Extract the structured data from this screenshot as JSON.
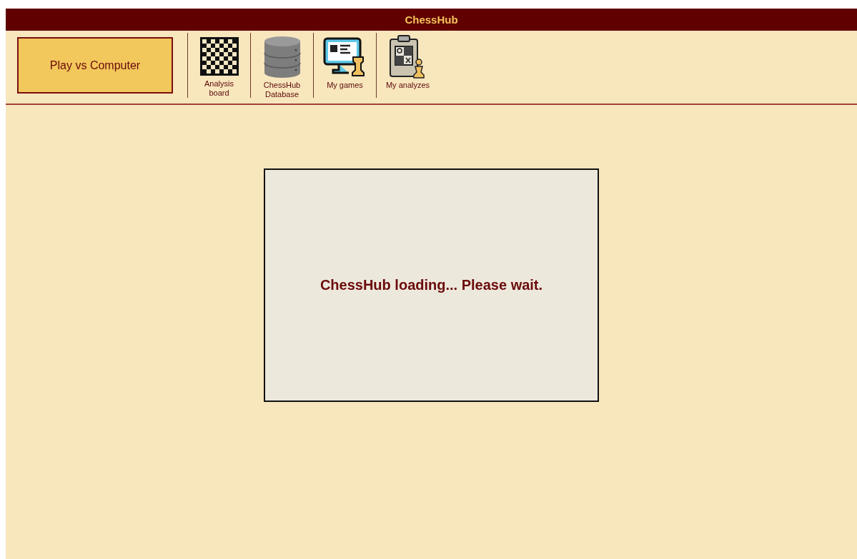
{
  "header": {
    "title": "ChessHub"
  },
  "toolbar": {
    "primary_button": "Play vs Computer",
    "items": [
      {
        "kind": "board",
        "label": "Analysis board"
      },
      {
        "kind": "database",
        "label": "ChessHub Database"
      },
      {
        "kind": "monitor",
        "label": "My games"
      },
      {
        "kind": "clipboard",
        "label": "My analyzes"
      }
    ]
  },
  "loading_panel": {
    "message": "ChessHub loading... Please wait."
  }
}
